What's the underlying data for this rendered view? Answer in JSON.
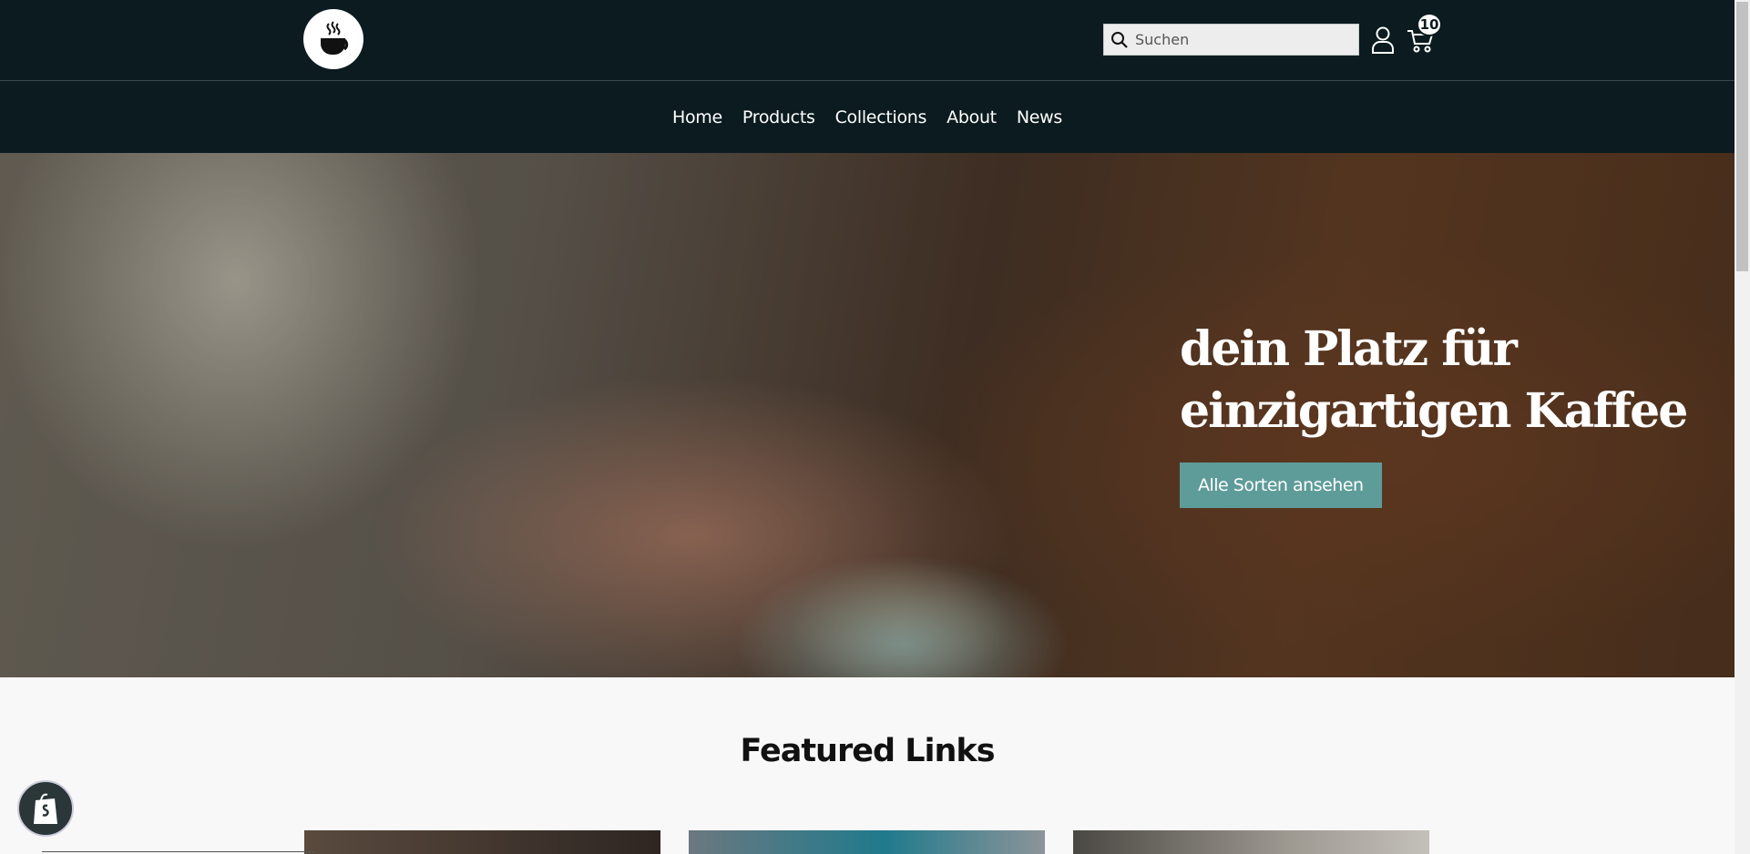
{
  "header": {
    "logo_icon": "coffee-cup-icon",
    "search": {
      "placeholder": "Suchen",
      "icon": "search-icon"
    },
    "account_icon": "user-icon",
    "cart": {
      "icon": "cart-icon",
      "count": "10"
    }
  },
  "nav": {
    "items": [
      {
        "label": "Home"
      },
      {
        "label": "Products"
      },
      {
        "label": "Collections"
      },
      {
        "label": "About"
      },
      {
        "label": "News"
      }
    ]
  },
  "hero": {
    "title": "dein Platz für einzigartigen Kaffee",
    "button_label": "Alle Sorten ansehen",
    "button_color": "#5e9c99"
  },
  "featured": {
    "title": "Featured Links"
  },
  "shopify_badge_icon": "shopify-bag-icon",
  "colors": {
    "header_bg": "#0b1b1f",
    "accent": "#5e9c99"
  }
}
